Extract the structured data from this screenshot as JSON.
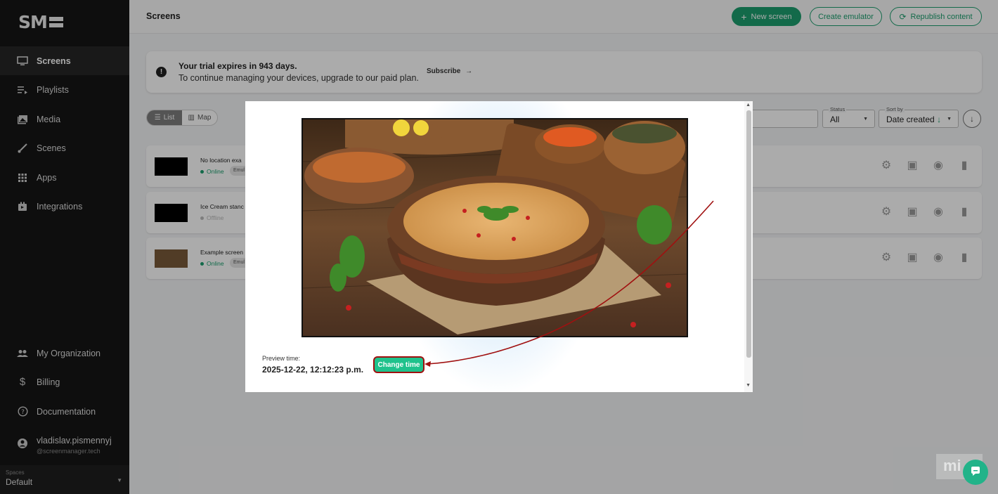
{
  "app": {
    "logo_text": "SM"
  },
  "sidebar": {
    "items": [
      {
        "label": "Screens",
        "icon": "monitor-icon",
        "active": true
      },
      {
        "label": "Playlists",
        "icon": "playlist-icon",
        "active": false
      },
      {
        "label": "Media",
        "icon": "image-icon",
        "active": false
      },
      {
        "label": "Scenes",
        "icon": "brush-icon",
        "active": false
      },
      {
        "label": "Apps",
        "icon": "grid-icon",
        "active": false
      },
      {
        "label": "Integrations",
        "icon": "plugin-icon",
        "active": false
      }
    ],
    "bottom_items": [
      {
        "label": "My Organization",
        "icon": "people-icon"
      },
      {
        "label": "Billing",
        "icon": "dollar-icon"
      },
      {
        "label": "Documentation",
        "icon": "help-icon"
      }
    ],
    "user": {
      "name": "vladislav.pismennyj",
      "email": "@screenmanager.tech"
    },
    "spaces": {
      "label": "Spaces",
      "value": "Default"
    }
  },
  "header": {
    "title": "Screens",
    "new_screen": "New screen",
    "create_emulator": "Create emulator",
    "republish": "Republish content"
  },
  "trial": {
    "title": "Your trial expires in 943 days.",
    "text": "To continue managing your devices, upgrade to our paid plan.",
    "subscribe": "Subscribe"
  },
  "view_toggle": {
    "list": "List",
    "map": "Map"
  },
  "filters": {
    "status_label": "Status",
    "status_value": "All",
    "sort_label": "Sort by",
    "sort_value": "Date created",
    "sort_arrow": "↓"
  },
  "screens": [
    {
      "name": "No location exa",
      "status": "Online",
      "badge": "Emul"
    },
    {
      "name": "Ice Cream stanc",
      "status": "Offline",
      "badge": ""
    },
    {
      "name": "Example screen",
      "status": "Online",
      "badge": "Emul"
    }
  ],
  "modal": {
    "preview_time_label": "Preview time:",
    "preview_time_value": "2025-12-22, 12:12:23 p.m.",
    "change_time": "Change time",
    "preview_image": "soup-bowl-image"
  },
  "colors": {
    "accent": "#1d9f6f",
    "highlight": "#a01010",
    "change_button": "#1fc28c"
  }
}
